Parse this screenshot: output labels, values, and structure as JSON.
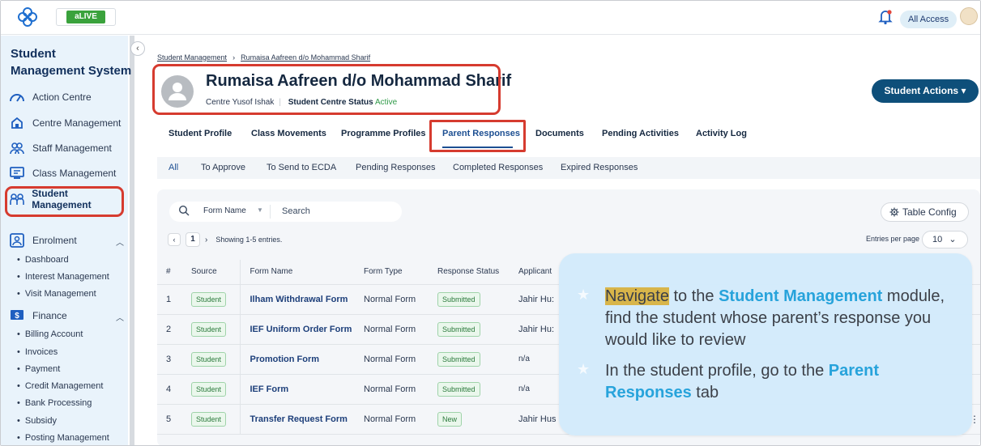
{
  "topbar": {
    "app_badge": "aLIVE",
    "access_label": "All Access"
  },
  "sidebar": {
    "title": "Student Management System",
    "items": [
      {
        "label": "Action Centre",
        "icon": "dashboard-icon"
      },
      {
        "label": "Centre Management",
        "icon": "centre-icon"
      },
      {
        "label": "Staff Management",
        "icon": "staff-icon"
      },
      {
        "label": "Class Management",
        "icon": "class-icon"
      },
      {
        "label": "Student Management",
        "icon": "student-icon"
      },
      {
        "label": "Enrolment",
        "icon": "enrolment-icon"
      },
      {
        "label": "Finance",
        "icon": "finance-icon"
      }
    ],
    "enrolment_sub": [
      "Dashboard",
      "Interest Management",
      "Visit Management"
    ],
    "finance_sub": [
      "Billing Account",
      "Invoices",
      "Payment",
      "Credit Management",
      "Bank Processing",
      "Subsidy",
      "Posting Management"
    ]
  },
  "breadcrumb": {
    "root": "Student Management",
    "current": "Rumaisa Aafreen d/o Mohammad Sharif"
  },
  "student": {
    "name": "Rumaisa Aafreen d/o Mohammad Sharif",
    "centre_label": "Centre",
    "centre": "Yusof Ishak",
    "status_label": "Student Centre Status",
    "status": "Active"
  },
  "actions_button": "Student Actions",
  "tabs": [
    "Student Profile",
    "Class Movements",
    "Programme Profiles",
    "Parent Responses",
    "Documents",
    "Pending Activities",
    "Activity Log"
  ],
  "subtabs": [
    "All",
    "To Approve",
    "To Send to ECDA",
    "Pending Responses",
    "Completed Responses",
    "Expired Responses"
  ],
  "search": {
    "field": "Form Name",
    "placeholder": "Search"
  },
  "table_config": "Table Config",
  "pager": {
    "page": "1",
    "showing": "Showing 1-5 entries.",
    "per_page_label": "Entries per page",
    "per_page": "10"
  },
  "table": {
    "headers": [
      "#",
      "Source",
      "Form Name",
      "Form Type",
      "Response Status",
      "Applicant"
    ],
    "rows": [
      {
        "idx": "1",
        "source": "Student",
        "name": "Ilham Withdrawal Form",
        "type": "Normal Form",
        "status": "Submitted",
        "applicant": "Jahir Hu:"
      },
      {
        "idx": "2",
        "source": "Student",
        "name": "IEF Uniform Order Form",
        "type": "Normal Form",
        "status": "Submitted",
        "applicant": "Jahir Hu:"
      },
      {
        "idx": "3",
        "source": "Student",
        "name": "Promotion Form",
        "type": "Normal Form",
        "status": "Submitted",
        "applicant": "n/a"
      },
      {
        "idx": "4",
        "source": "Student",
        "name": "IEF Form",
        "type": "Normal Form",
        "status": "Submitted",
        "applicant": "n/a"
      },
      {
        "idx": "5",
        "source": "Student",
        "name": "Transfer Request Form",
        "type": "Normal Form",
        "status": "New",
        "applicant": "Jahir Hus"
      }
    ]
  },
  "callout": {
    "b1_hl": "Navigate",
    "b1_mid": " to the ",
    "b1_kw": "Student Management",
    "b1_rest": "module, find the student whose parent’s response you would like to review",
    "b2_pre": "In the student profile, go to the ",
    "b2_kw": "Parent Responses",
    "b2_rest": " tab"
  }
}
